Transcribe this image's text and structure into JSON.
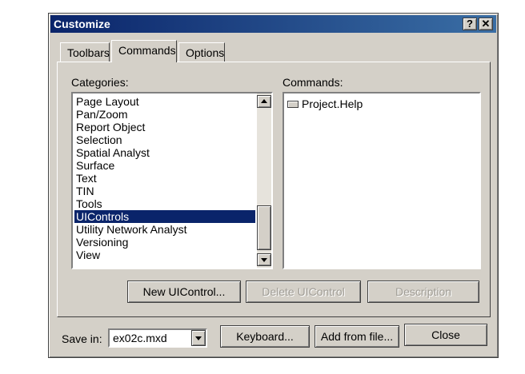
{
  "dialog": {
    "title": "Customize",
    "help_glyph": "?",
    "close_glyph": "✕"
  },
  "tabs": [
    {
      "label": "Toolbars",
      "active": false
    },
    {
      "label": "Commands",
      "active": true
    },
    {
      "label": "Options",
      "active": false
    }
  ],
  "categories": {
    "label": "Categories:",
    "items": [
      "Page Layout",
      "Pan/Zoom",
      "Report Object",
      "Selection",
      "Spatial Analyst",
      "Surface",
      "Text",
      "TIN",
      "Tools",
      "UIControls",
      "Utility Network Analyst",
      "Versioning",
      "View"
    ],
    "selected": "UIControls"
  },
  "commands": {
    "label": "Commands:",
    "items": [
      "Project.Help"
    ]
  },
  "buttons": {
    "new_uicontrol": "New UIControl...",
    "delete_uicontrol": "Delete UIControl",
    "description": "Description",
    "keyboard": "Keyboard...",
    "add_from_file": "Add from file...",
    "close": "Close"
  },
  "save_in": {
    "label": "Save in:",
    "value": "ex02c.mxd"
  },
  "colors": {
    "titlebar": "#0a246a",
    "selection": "#0a246a",
    "face": "#d4d0c8",
    "callout_arrow": "#f07030"
  },
  "icons": {
    "help": "question-mark-icon",
    "close": "close-icon",
    "command": "button-command-icon",
    "callout": "orange-arrow-icon"
  }
}
